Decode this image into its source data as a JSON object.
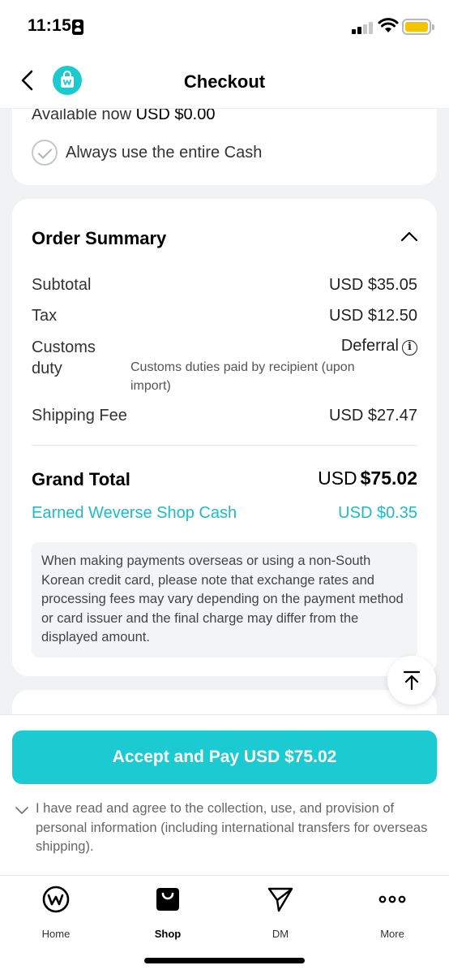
{
  "status": {
    "time": "11:15"
  },
  "header": {
    "title": "Checkout"
  },
  "cash": {
    "available_label": "Available now",
    "available_value": "USD $0.00",
    "always_use_label": "Always use the entire Cash"
  },
  "summary": {
    "title": "Order Summary",
    "subtotal_label": "Subtotal",
    "subtotal_value": "USD $35.05",
    "tax_label": "Tax",
    "tax_value": "USD $12.50",
    "customs_label_1": "Customs",
    "customs_label_2": "duty",
    "customs_value": "Deferral",
    "customs_note": "Customs duties paid by recipient (upon import)",
    "shipping_label": "Shipping Fee",
    "shipping_value": "USD $27.47",
    "grand_label": "Grand Total",
    "grand_currency": "USD",
    "grand_amount": "$75.02",
    "earned_label": "Earned Weverse Shop Cash",
    "earned_value": "USD $0.35",
    "notice": "When making payments overseas or using a non-South Korean credit card, please note that exchange rates and processing fees may vary depending on the payment method or card issuer and the final charge may differ from the displayed amount."
  },
  "pay": {
    "button_label": "Accept and Pay USD $75.02",
    "agreement": "I have read and agree to the collection, use, and provision of personal information (including international transfers for overseas shipping)."
  },
  "tabs": [
    {
      "label": "Home",
      "icon": "weverse-home-icon"
    },
    {
      "label": "Shop",
      "icon": "shopping-bag-icon",
      "active": true
    },
    {
      "label": "DM",
      "icon": "paper-plane-icon"
    },
    {
      "label": "More",
      "icon": "more-dots-icon"
    }
  ],
  "colors": {
    "accent": "#1ccad1",
    "earned": "#1bbdc3",
    "background": "#f1f2f4"
  }
}
